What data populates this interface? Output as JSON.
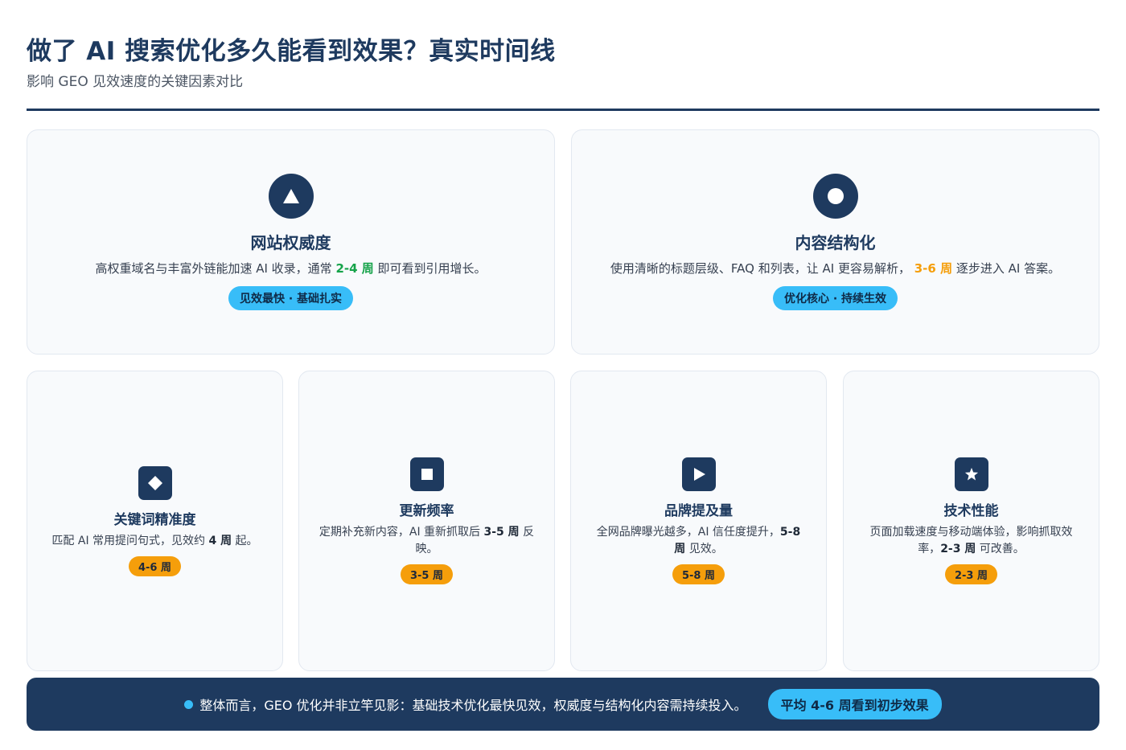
{
  "header": {
    "title": "做了 AI 搜索优化多久能看到效果？真实时间线",
    "subtitle": "影响 GEO 见效速度的关键因素对比"
  },
  "cards": [
    {
      "icon": "triangle-icon",
      "title": "网站权威度",
      "desc_pre": "高权重域名与丰富外链能加速 AI 收录，通常 ",
      "desc_hl": "2-4 周",
      "desc_post": " 即可看到引用增长。",
      "badge": "见效最快 · 基础扎实"
    },
    {
      "icon": "circle-icon",
      "title": "内容结构化",
      "desc_pre": "使用清晰的标题层级、FAQ 和列表，让 AI 更容易解析， ",
      "desc_hl": "3-6 周",
      "desc_post": " 逐步进入 AI 答案。",
      "badge": "优化核心 · 持续生效"
    },
    {
      "icon": "diamond-icon",
      "title": "关键词精准度",
      "desc_pre": "匹配 AI 常用提问句式，见效约 ",
      "desc_hl": "4 周",
      "desc_post": " 起。",
      "badge": "4-6 周"
    },
    {
      "icon": "square-icon",
      "title": "更新频率",
      "desc_pre": "定期补充新内容，AI 重新抓取后 ",
      "desc_hl": "3-5 周",
      "desc_post": " 反映。",
      "badge": "3-5 周"
    },
    {
      "icon": "play-icon",
      "title": "品牌提及量",
      "desc_pre": "全网品牌曝光越多，AI 信任度提升，",
      "desc_hl": "5-8 周",
      "desc_post": " 见效。",
      "badge": "5-8 周"
    },
    {
      "icon": "star-icon",
      "title": "技术性能",
      "desc_pre": "页面加载速度与移动端体验，影响抓取效率，",
      "desc_hl": "2-3 周",
      "desc_post": " 可改善。",
      "badge": "2-3 周"
    }
  ],
  "footer": {
    "text": "整体而言，GEO 优化并非立竿见影：基础技术优化最快见效，权威度与结构化内容需持续投入。",
    "badge": "平均 4-6 周看到初步效果"
  },
  "colors": {
    "navy": "#1e3a5f",
    "sky": "#38bdf8",
    "green": "#16a34a",
    "orange": "#f59e0b",
    "card_bg": "#f8fafc"
  }
}
